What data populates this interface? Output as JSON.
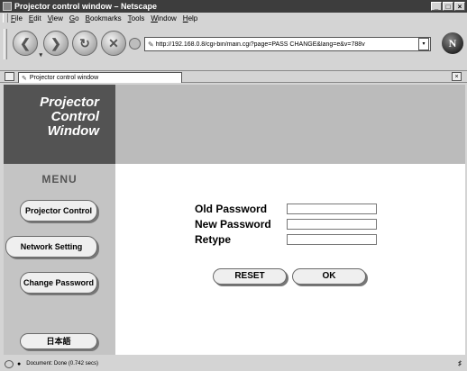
{
  "window": {
    "title": "Projector control window – Netscape",
    "controls": [
      "_",
      "□",
      "×"
    ]
  },
  "menubar": [
    "File",
    "Edit",
    "View",
    "Go",
    "Bookmarks",
    "Tools",
    "Window",
    "Help"
  ],
  "navigation": {
    "url": "http://192.168.0.8/cgi-bin/main.cgi?page=PASS CHANGE&lang=e&v=788v",
    "buttons": [
      "back-icon",
      "forward-icon",
      "reload-icon",
      "stop-icon"
    ],
    "logo_letter": "N"
  },
  "tabs": {
    "active_label": "Projector control window"
  },
  "page": {
    "logo_lines": [
      "Projector",
      "Control",
      "Window"
    ],
    "menu_label": "MENU",
    "sidebar": {
      "projector_control": "Projector Control",
      "network_setting": "Network Setting",
      "change_password": "Change Password",
      "language": "日本語"
    },
    "form": {
      "old_password_label": "Old Password",
      "new_password_label": "New Password",
      "retype_label": "Retype",
      "old_password_value": "",
      "new_password_value": "",
      "retype_value": "",
      "reset_label": "RESET",
      "ok_label": "OK"
    }
  },
  "status": {
    "text": "Document: Done (0.742 secs)"
  }
}
